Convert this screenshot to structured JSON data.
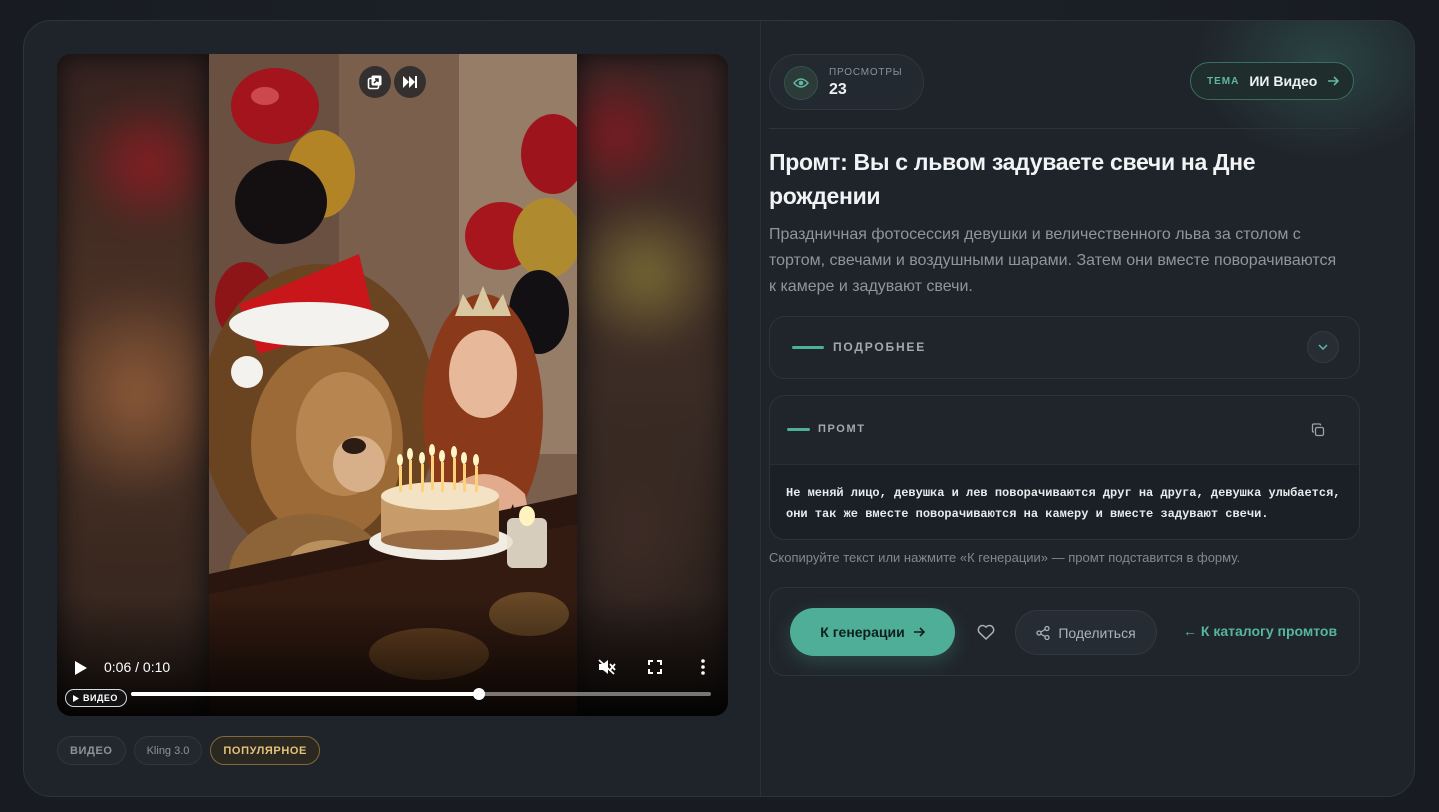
{
  "video": {
    "time": "0:06 / 0:10",
    "progress_fraction": 0.6,
    "badge_label": "ВИДЕО",
    "controls": [
      "play-icon",
      "mute-icon",
      "fullscreen-icon",
      "more-vertical-icon"
    ],
    "top_buttons": [
      "picture-in-picture-icon",
      "skip-next-icon"
    ]
  },
  "tags": [
    {
      "label": "ВИДЕО"
    },
    {
      "label": "Kling 3.0"
    },
    {
      "label": "ПОПУЛЯРНОЕ"
    }
  ],
  "stats": {
    "views_label": "ПРОСМОТРЫ",
    "views_count": "23"
  },
  "theme": {
    "label": "ТЕМА",
    "name": "ИИ Видео"
  },
  "prompt_page": {
    "title": "Промт: Вы с львом задуваете свечи на Дне рождении",
    "description": "Праздничная фотосессия девушки и величественного льва за столом с тортом, свечами и воздушными шарами. Затем они вместе поворачиваются к камере и задувают свечи.",
    "details_label": "ПОДРОБНЕЕ",
    "prompt_label": "ПРОМТ",
    "prompt_text": "Не меняй лицо, девушка и лев поворачиваются друг на друга, девушка улыбается, они так же вместе поворачиваются на камеру и вместе задувают свечи.",
    "hint": "Скопируйте текст или нажмите «К генерации» — промт подставится в форму."
  },
  "actions": {
    "generate_label": "К генерации",
    "share_label": "Поделиться",
    "catalog_label": "← К каталогу промтов"
  },
  "colors": {
    "accent": "#4fae98",
    "gold_tag": "#e3c27a",
    "background": "#1f242b"
  }
}
